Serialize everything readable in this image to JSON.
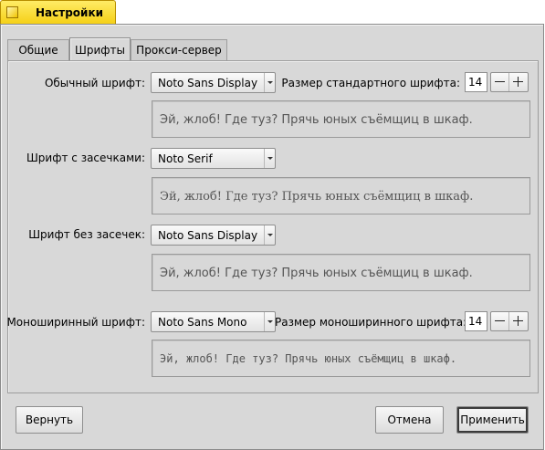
{
  "window": {
    "title": "Настройки"
  },
  "tabs": [
    {
      "label": "Общие"
    },
    {
      "label": "Шрифты",
      "active": true
    },
    {
      "label": "Прокси-сервер"
    }
  ],
  "fonts": {
    "regular": {
      "label": "Обычный шрифт:",
      "value": "Noto Sans Display",
      "size_label": "Размер стандартного шрифта:",
      "size_value": "14",
      "preview": "Эй, жлоб! Где туз? Прячь юных съёмщиц в шкаф."
    },
    "serif": {
      "label": "Шрифт с засечками:",
      "value": "Noto Serif",
      "preview": "Эй, жлоб! Где туз? Прячь юных съёмщиц в шкаф."
    },
    "sans": {
      "label": "Шрифт без засечек:",
      "value": "Noto Sans Display",
      "preview": "Эй, жлоб! Где туз? Прячь юных съёмщиц в шкаф."
    },
    "mono": {
      "label": "Моноширинный шрифт:",
      "value": "Noto Sans Mono",
      "size_label": "Размер моноширинного шрифта:",
      "size_value": "14",
      "preview": "Эй, жлоб! Где туз? Прячь юных съёмщиц в шкаф."
    }
  },
  "buttons": {
    "revert": "Вернуть",
    "cancel": "Отмена",
    "apply": "Применить"
  },
  "colors": {
    "window_bg": "#d8d8d8",
    "title_tab": "#ffd800"
  }
}
